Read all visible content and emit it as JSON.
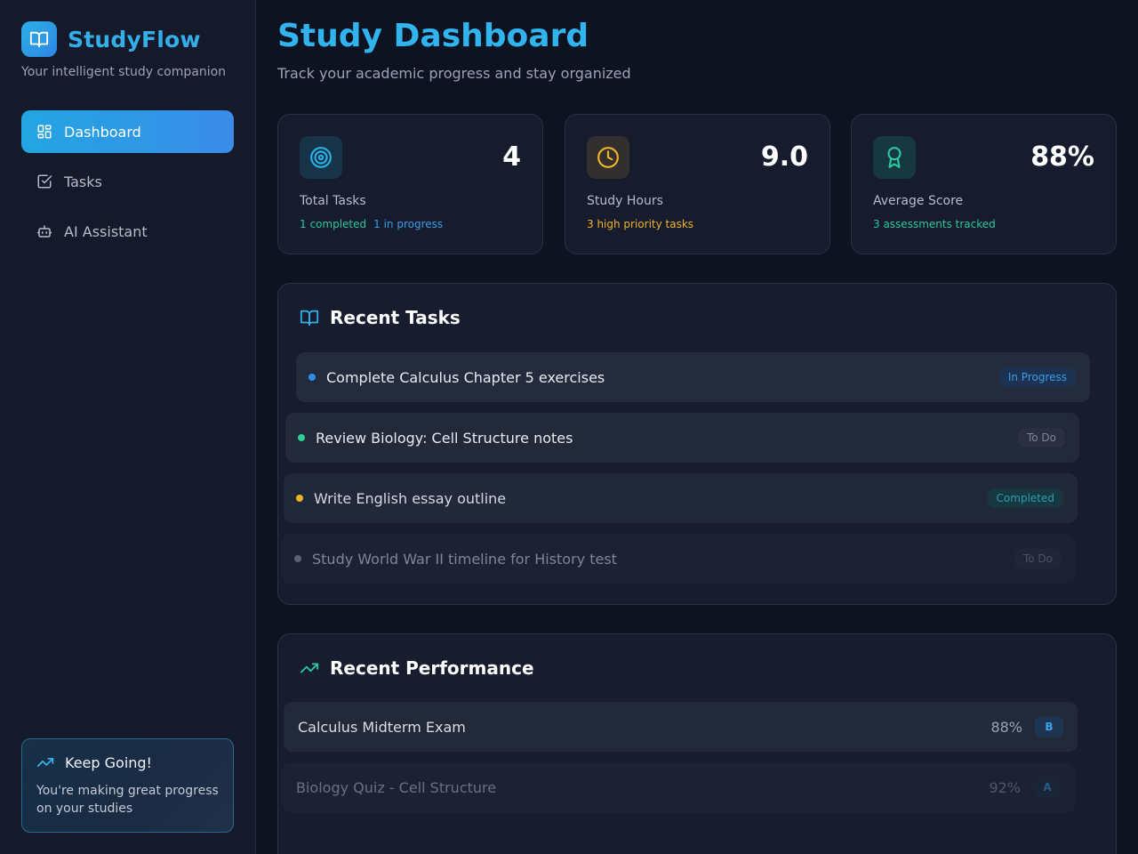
{
  "sidebar": {
    "brand_name": "StudyFlow",
    "brand_sub": "Your intelligent study companion",
    "nav": [
      {
        "label": "Dashboard",
        "icon": "dashboard-icon",
        "active": true
      },
      {
        "label": "Tasks",
        "icon": "checkbox-icon",
        "active": false
      },
      {
        "label": "AI Assistant",
        "icon": "robot-icon",
        "active": false
      }
    ],
    "keep_going": {
      "title": "Keep Going!",
      "text": "You're making great progress on your studies"
    }
  },
  "header": {
    "title": "Study Dashboard",
    "subtitle": "Track your academic progress and stay organized"
  },
  "stats": [
    {
      "value": "4",
      "label": "Total Tasks",
      "sub": [
        "1 completed",
        "1 in progress"
      ],
      "icon": "target-icon",
      "color": "#2bb0e6"
    },
    {
      "value": "9.0",
      "label": "Study Hours",
      "sub": [
        "3 high priority tasks"
      ],
      "icon": "clock-icon",
      "color": "#f0b429"
    },
    {
      "value": "88%",
      "label": "Average Score",
      "sub": [
        "3 assessments tracked"
      ],
      "icon": "award-icon",
      "color": "#2cc6a0"
    }
  ],
  "recent_tasks": {
    "title": "Recent Tasks",
    "items": [
      {
        "text": "Complete Calculus Chapter 5 exercises",
        "status": "In Progress",
        "dot": "#2f8fe8"
      },
      {
        "text": "Review Biology: Cell Structure notes",
        "status": "To Do",
        "dot": "#2ccf8f"
      },
      {
        "text": "Write English essay outline",
        "status": "Completed",
        "dot": "#f0b429"
      },
      {
        "text": "Study World War II timeline for History test",
        "status": "To Do",
        "dot": "#7d8596"
      }
    ]
  },
  "recent_performance": {
    "title": "Recent Performance",
    "items": [
      {
        "name": "Calculus Midterm Exam",
        "score": "88%",
        "grade": "B"
      },
      {
        "name": "Biology Quiz - Cell Structure",
        "score": "92%",
        "grade": "A"
      }
    ]
  }
}
